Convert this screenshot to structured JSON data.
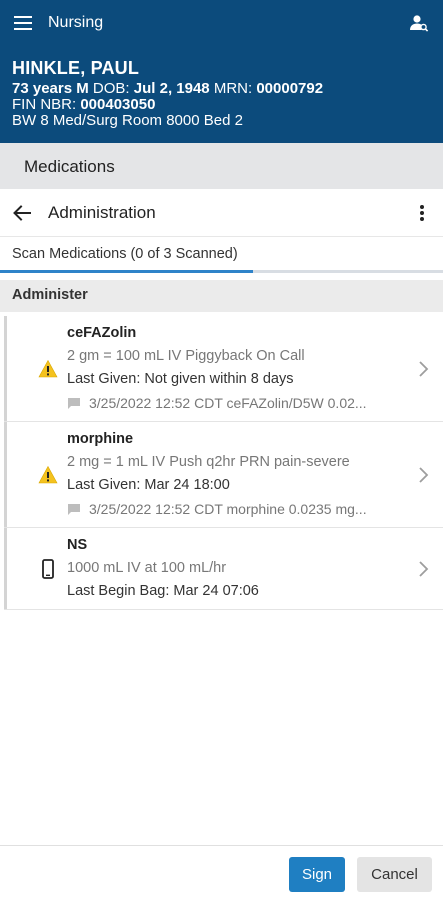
{
  "app": {
    "title": "Nursing"
  },
  "patient": {
    "name": "HINKLE, PAUL",
    "age_sex": "73 years M",
    "dob_label": "DOB:",
    "dob": "Jul 2, 1948",
    "mrn_label": "MRN:",
    "mrn": "00000792",
    "fin_label": "FIN NBR:",
    "fin": "000403050",
    "location": "BW 8 Med/Surg Room 8000 Bed 2"
  },
  "section": {
    "label": "Medications"
  },
  "page": {
    "title": "Administration"
  },
  "scan_tab": {
    "label": "Scan Medications (0 of 3 Scanned)",
    "progress_fraction": 0.57
  },
  "group": {
    "label": "Administer"
  },
  "medications": [
    {
      "name": "ceFAZolin",
      "icon": "warning-icon",
      "order": "2 gm = 100 mL IV Piggyback On Call",
      "last": "Last Given: Not given within 8 days",
      "comment": "3/25/2022 12:52 CDT ceFAZolin/D5W 0.02..."
    },
    {
      "name": "morphine",
      "icon": "warning-icon",
      "order": "2 mg = 1 mL IV Push q2hr PRN pain-severe",
      "last": "Last Given: Mar 24 18:00",
      "comment": "3/25/2022 12:52 CDT morphine 0.0235 mg..."
    },
    {
      "name": "NS",
      "icon": "device-icon",
      "order": "1000 mL IV at 100 mL/hr",
      "last": "Last Begin Bag: Mar 24 07:06"
    }
  ],
  "footer": {
    "sign_label": "Sign",
    "cancel_label": "Cancel"
  },
  "colors": {
    "header": "#0c4b7c",
    "accent": "#1f7fc2",
    "warning": "#f4c21f"
  }
}
